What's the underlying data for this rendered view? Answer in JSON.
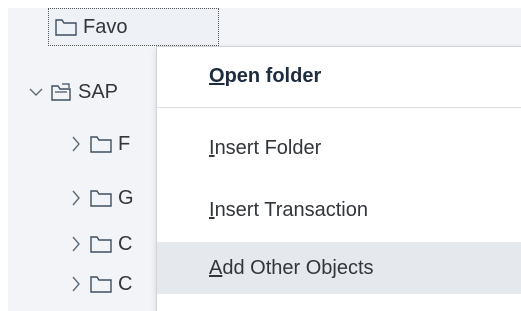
{
  "tree": {
    "favorites": {
      "label": "Favo",
      "icon": "folder-icon"
    },
    "sap_menu": {
      "label": "SAP",
      "icon": "sap-menu-icon",
      "expanded": true
    },
    "children": [
      {
        "label": "F",
        "icon": "folder-icon",
        "expanded": false
      },
      {
        "label": "G",
        "icon": "folder-icon",
        "expanded": false
      },
      {
        "label": "C",
        "icon": "folder-icon",
        "expanded": false
      },
      {
        "label": "C",
        "icon": "folder-icon",
        "expanded": false
      }
    ]
  },
  "context_menu": {
    "items": [
      {
        "label_mnemonic": "O",
        "label_rest": "pen folder",
        "default": true
      },
      {
        "label_mnemonic": "I",
        "label_rest": "nsert Folder"
      },
      {
        "label_mnemonic": "I",
        "label_rest": "nsert Transaction"
      },
      {
        "label_mnemonic": "A",
        "label_rest": "dd Other Objects",
        "highlighted": true
      }
    ]
  },
  "colors": {
    "panel_bg": "#f2f4f7",
    "menu_bg": "#ffffff",
    "hover_bg": "#e5e8ed",
    "text": "#32363a",
    "icon_stroke": "#3d4e63"
  }
}
